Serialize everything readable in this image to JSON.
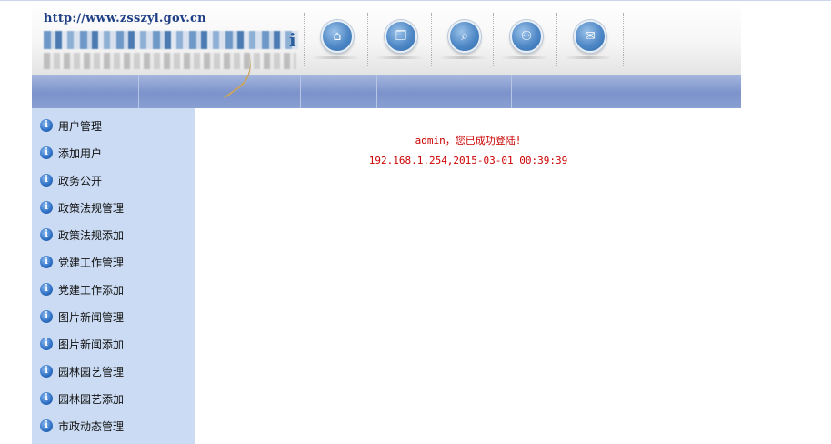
{
  "header": {
    "site_url": "http://www.zsszyl.gov.cn",
    "icons": [
      {
        "name": "home-icon",
        "glyph": "⌂"
      },
      {
        "name": "copy-icon",
        "glyph": "❐"
      },
      {
        "name": "search-icon",
        "glyph": "⌕"
      },
      {
        "name": "sitemap-icon",
        "glyph": "⚇"
      },
      {
        "name": "mail-icon",
        "glyph": "✉"
      }
    ]
  },
  "colors": {
    "sidebar_bg": "#cadbf3",
    "nav_band": "#7b92cb",
    "message_red": "#cc0000",
    "url_blue": "#1f3f86"
  },
  "sidebar": {
    "items": [
      {
        "label": "用户管理"
      },
      {
        "label": "添加用户"
      },
      {
        "label": "政务公开"
      },
      {
        "label": "政策法规管理"
      },
      {
        "label": "政策法规添加"
      },
      {
        "label": "党建工作管理"
      },
      {
        "label": "党建工作添加"
      },
      {
        "label": "图片新闻管理"
      },
      {
        "label": "图片新闻添加"
      },
      {
        "label": "园林园艺管理"
      },
      {
        "label": "园林园艺添加"
      },
      {
        "label": "市政动态管理"
      }
    ]
  },
  "main": {
    "welcome": "admin，您已成功登陆!",
    "login_info": "192.168.1.254,2015-03-01 00:39:39"
  }
}
